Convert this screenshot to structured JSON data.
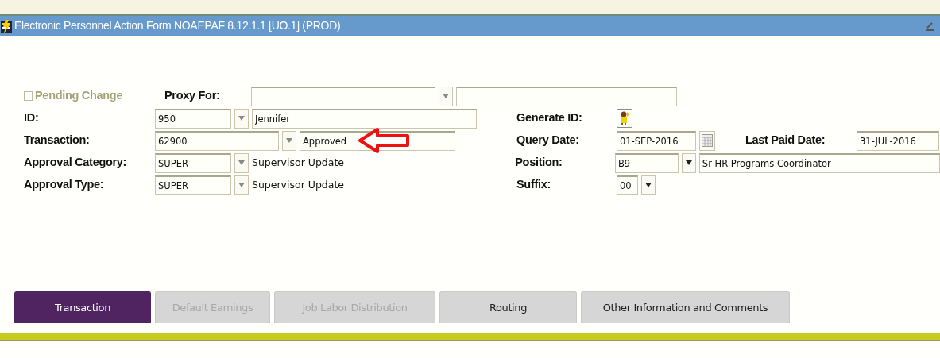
{
  "window": {
    "title": "Electronic Personnel Action Form  NOAEPAF  8.12.1.1  [UO.1]  (PROD)"
  },
  "pending_change": {
    "label": "Pending Change",
    "checked": false
  },
  "proxy_for": {
    "label": "Proxy For:"
  },
  "id": {
    "label": "ID:",
    "code": "950",
    "name": "Jennifer"
  },
  "generate_id": {
    "label": "Generate ID:"
  },
  "transaction": {
    "label": "Transaction:",
    "code": "62900",
    "status": "Approved"
  },
  "query_date": {
    "label": "Query Date:",
    "value": "01-SEP-2016"
  },
  "last_paid_date": {
    "label": "Last Paid Date:",
    "value": "31-JUL-2016"
  },
  "approval_category": {
    "label": "Approval Category:",
    "code": "SUPER",
    "description": "Supervisor Update"
  },
  "position": {
    "label": "Position:",
    "code": "B9",
    "title": "Sr HR Programs Coordinator"
  },
  "approval_type": {
    "label": "Approval Type:",
    "code": "SUPER",
    "description": "Supervisor Update"
  },
  "suffix": {
    "label": "Suffix:",
    "value": "00"
  },
  "tabs": [
    {
      "label": "Transaction",
      "selected": true,
      "disabled": false
    },
    {
      "label": "Default Earnings",
      "selected": false,
      "disabled": true
    },
    {
      "label": "Job Labor Distribution",
      "selected": false,
      "disabled": true
    },
    {
      "label": "Routing",
      "selected": false,
      "disabled": false
    },
    {
      "label": "Other Information and Comments",
      "selected": false,
      "disabled": false
    }
  ]
}
